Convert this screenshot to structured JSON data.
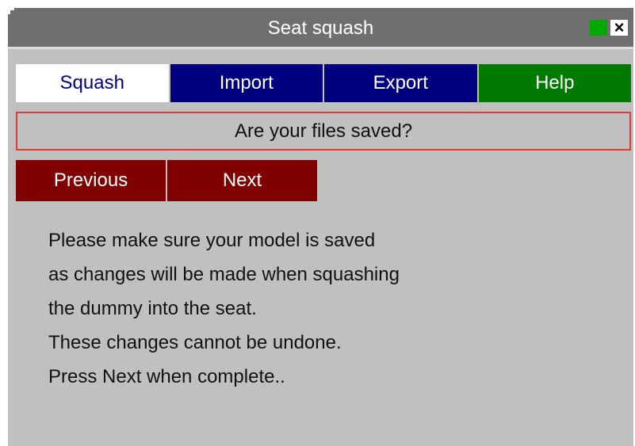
{
  "window": {
    "title": "Seat squash",
    "close_glyph": "×"
  },
  "tabs": [
    {
      "label": "Squash",
      "active": true
    },
    {
      "label": "Import",
      "active": false
    },
    {
      "label": "Export",
      "active": false
    },
    {
      "label": "Help",
      "active": false
    }
  ],
  "banner": {
    "text": "Are your files saved?"
  },
  "nav": {
    "previous_label": "Previous",
    "next_label": "Next"
  },
  "message": {
    "lines": [
      "Please make sure your model is saved",
      "as changes will be made when squashing",
      "the dummy into the seat.",
      "These changes cannot be undone.",
      "Press Next when complete.."
    ]
  },
  "colors": {
    "titlebar": "#6f6f6f",
    "panel": "#c0c0c0",
    "tab_blue": "#000080",
    "tab_green": "#007a00",
    "nav_maroon": "#800000",
    "banner_border": "#e03a3a"
  }
}
